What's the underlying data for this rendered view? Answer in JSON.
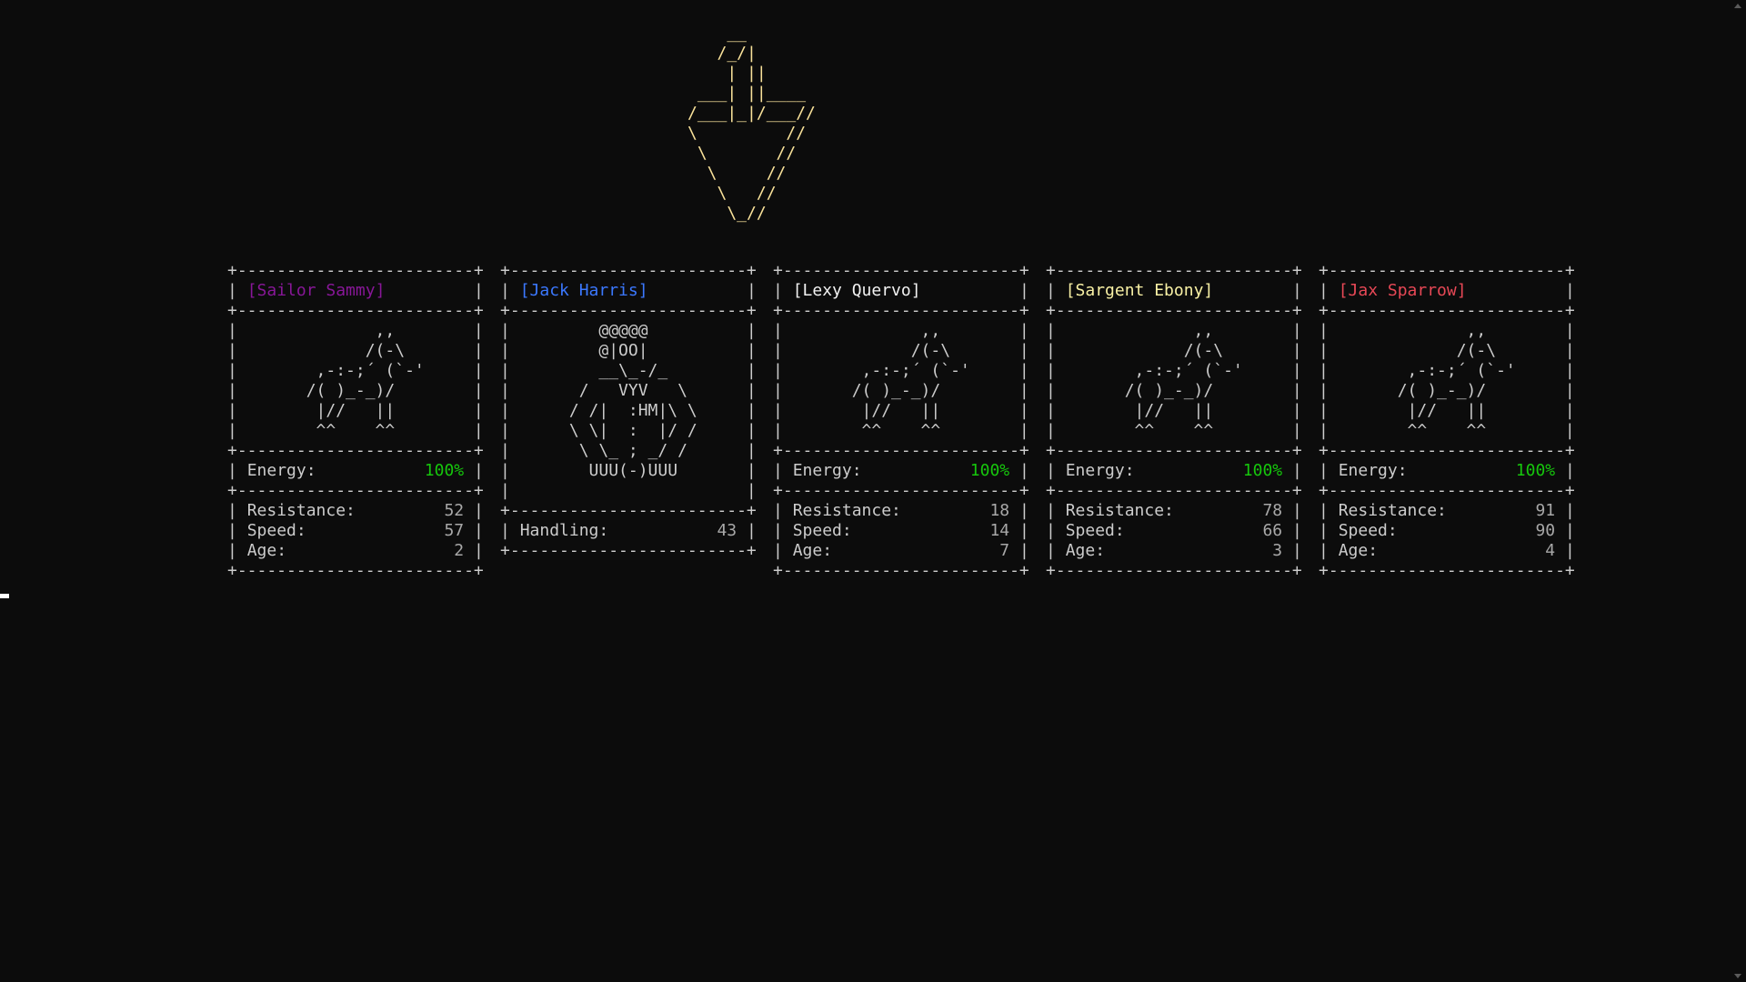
{
  "logo": {
    "art": "    __\n   /_/|\n    | ||\n ___| ||____\n/___|_|/___//\n\\         //\n \\       //\n  \\     //\n   \\   //\n    \\_//"
  },
  "colors": {
    "background": "#0c0c0c",
    "text": "#cccccc",
    "logo": "#f9e29a",
    "energy": "#16c60c",
    "sailor_sammy": "#881798",
    "jack_harris": "#3b78ff",
    "lexy_quervo": "#f2f2f2",
    "sargent_ebony": "#f9f1a5",
    "jax_sparrow": "#e74856"
  },
  "cards": [
    {
      "name": "[Sailor Sammy]",
      "color": "#881798",
      "art": "         ,,\n        /(-\\\n   ,-:-;´ (`-'\n  /( )_-_)/\n   |//   ||\n   ^^    ^^",
      "energy_label": "Energy:",
      "energy_value": "100%",
      "stats": [
        {
          "label": "Resistance:",
          "value": "52"
        },
        {
          "label": "Speed:",
          "value": "57"
        },
        {
          "label": "Age:",
          "value": "2"
        }
      ]
    },
    {
      "name": "[Jack Harris]",
      "color": "#3b78ff",
      "art": "     @@@@@\n     @|OO|\n     __\\_-/_\n   /   VYV   \\\n  / /|  :HM|\\ \\\n  \\ \\|  :  |/ /\n   \\ \\_ ; _/ /\n    UUU(-)UUU",
      "stats": [
        {
          "label": "Handling:",
          "value": "43"
        }
      ]
    },
    {
      "name": "[Lexy Quervo]",
      "color": "#f2f2f2",
      "art": "         ,,\n        /(-\\\n   ,-:-;´ (`-'\n  /( )_-_)/\n   |//   ||\n   ^^    ^^",
      "energy_label": "Energy:",
      "energy_value": "100%",
      "stats": [
        {
          "label": "Resistance:",
          "value": "18"
        },
        {
          "label": "Speed:",
          "value": "14"
        },
        {
          "label": "Age:",
          "value": "7"
        }
      ]
    },
    {
      "name": "[Sargent Ebony]",
      "color": "#f9f1a5",
      "art": "         ,,\n        /(-\\\n   ,-:-;´ (`-'\n  /( )_-_)/\n   |//   ||\n   ^^    ^^",
      "energy_label": "Energy:",
      "energy_value": "100%",
      "stats": [
        {
          "label": "Resistance:",
          "value": "78"
        },
        {
          "label": "Speed:",
          "value": "66"
        },
        {
          "label": "Age:",
          "value": "3"
        }
      ]
    },
    {
      "name": "[Jax Sparrow]",
      "color": "#e74856",
      "art": "         ,,\n        /(-\\\n   ,-:-;´ (`-'\n  /( )_-_)/\n   |//   ||\n   ^^    ^^",
      "energy_label": "Energy:",
      "energy_value": "100%",
      "stats": [
        {
          "label": "Resistance:",
          "value": "91"
        },
        {
          "label": "Speed:",
          "value": "90"
        },
        {
          "label": "Age:",
          "value": "4"
        }
      ]
    }
  ]
}
